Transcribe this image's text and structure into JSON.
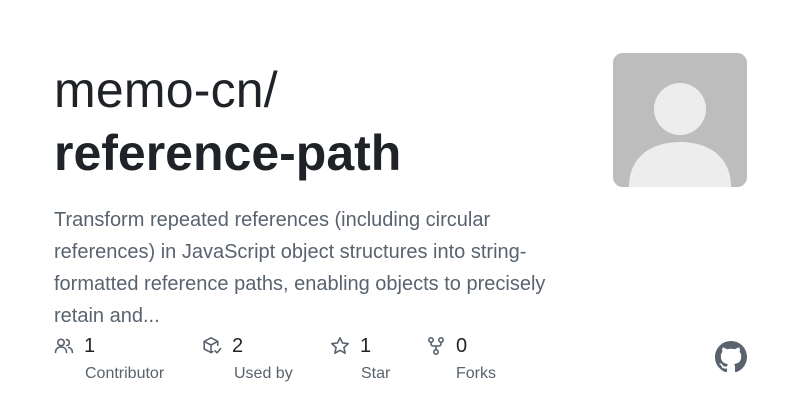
{
  "repo": {
    "owner_line": "memo-cn/",
    "name": "reference-path",
    "description": "Transform repeated references (including circular references) in JavaScript object structures into string-formatted reference paths, enabling objects to precisely retain and..."
  },
  "avatar": {
    "icon": "default-user-avatar-icon",
    "background_color": "#bdbdbd",
    "figure_color": "#ededed"
  },
  "stats": {
    "contributors": {
      "icon": "people-icon",
      "count": "1",
      "label": "Contributor"
    },
    "used_by": {
      "icon": "package-dependents-icon",
      "count": "2",
      "label": "Used by"
    },
    "stars": {
      "icon": "star-icon",
      "count": "1",
      "label": "Star"
    },
    "forks": {
      "icon": "repo-forked-icon",
      "count": "0",
      "label": "Forks"
    }
  },
  "branding": {
    "logo": "github-mark-icon",
    "logo_color": "#59636e"
  },
  "colors": {
    "title": "#1f2328",
    "muted_text": "#59636e"
  }
}
